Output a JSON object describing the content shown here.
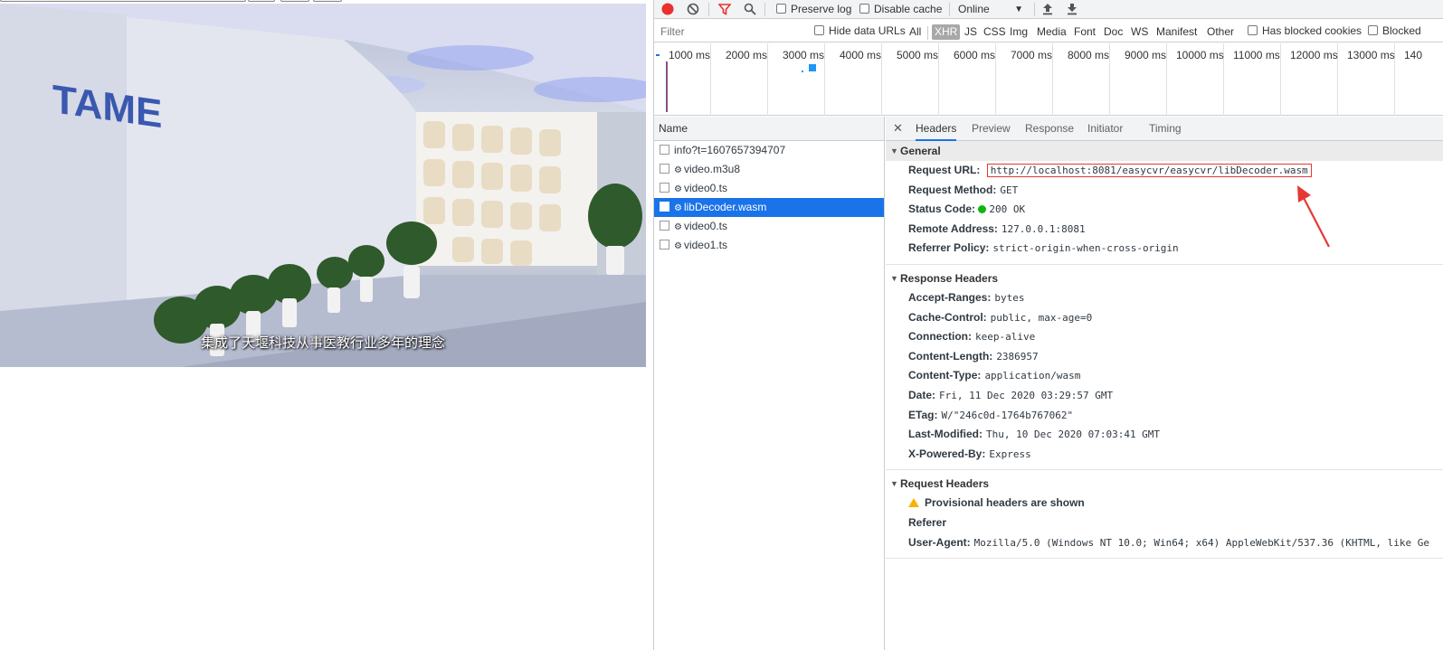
{
  "video": {
    "subtitle": "集成了天堰科技从事医教行业多年的理念"
  },
  "toolbar": {
    "preserve_log": "Preserve log",
    "disable_cache": "Disable cache",
    "throttle": "Online",
    "record_icon": "record-icon",
    "clear_icon": "clear-icon",
    "filter_icon": "filter-icon",
    "search_icon": "search-icon",
    "upload_icon": "upload-icon",
    "download_icon": "download-icon"
  },
  "filterbar": {
    "placeholder": "Filter",
    "hide_data_urls": "Hide data URLs",
    "types": [
      "All",
      "XHR",
      "JS",
      "CSS",
      "Img",
      "Media",
      "Font",
      "Doc",
      "WS",
      "Manifest",
      "Other"
    ],
    "active_type": "XHR",
    "has_blocked_cookies": "Has blocked cookies",
    "blocked": "Blocked"
  },
  "timeline": {
    "ticks": [
      "1000 ms",
      "2000 ms",
      "3000 ms",
      "4000 ms",
      "5000 ms",
      "6000 ms",
      "7000 ms",
      "8000 ms",
      "9000 ms",
      "10000 ms",
      "11000 ms",
      "12000 ms",
      "13000 ms",
      "140"
    ]
  },
  "requests": {
    "header": "Name",
    "rows": [
      {
        "name": "info?t=1607657394707",
        "gear": false,
        "selected": false
      },
      {
        "name": "video.m3u8",
        "gear": true,
        "selected": false
      },
      {
        "name": "video0.ts",
        "gear": true,
        "selected": false
      },
      {
        "name": "libDecoder.wasm",
        "gear": true,
        "selected": true
      },
      {
        "name": "video0.ts",
        "gear": true,
        "selected": false
      },
      {
        "name": "video1.ts",
        "gear": true,
        "selected": false
      }
    ]
  },
  "detail_tabs": [
    "Headers",
    "Preview",
    "Response",
    "Initiator",
    "Timing"
  ],
  "active_tab": "Headers",
  "general": {
    "title": "General",
    "rows": [
      {
        "key": "Request URL:",
        "value": "http://localhost:8081/easycvr/easycvr/libDecoder.wasm"
      },
      {
        "key": "Request Method:",
        "value": "GET"
      },
      {
        "key": "Status Code:",
        "value": "200 OK"
      },
      {
        "key": "Remote Address:",
        "value": "127.0.0.1:8081"
      },
      {
        "key": "Referrer Policy:",
        "value": "strict-origin-when-cross-origin"
      }
    ]
  },
  "response_headers": {
    "title": "Response Headers",
    "rows": [
      {
        "key": "Accept-Ranges:",
        "value": "bytes"
      },
      {
        "key": "Cache-Control:",
        "value": "public, max-age=0"
      },
      {
        "key": "Connection:",
        "value": "keep-alive"
      },
      {
        "key": "Content-Length:",
        "value": "2386957"
      },
      {
        "key": "Content-Type:",
        "value": "application/wasm"
      },
      {
        "key": "Date:",
        "value": "Fri, 11 Dec 2020 03:29:57 GMT"
      },
      {
        "key": "ETag:",
        "value": "W/\"246c0d-1764b767062\""
      },
      {
        "key": "Last-Modified:",
        "value": "Thu, 10 Dec 2020 07:03:41 GMT"
      },
      {
        "key": "X-Powered-By:",
        "value": "Express"
      }
    ]
  },
  "request_headers": {
    "title": "Request Headers",
    "warning": "Provisional headers are shown",
    "rows": [
      {
        "key": "Referer",
        "value": ""
      },
      {
        "key": "User-Agent:",
        "value": "Mozilla/5.0 (Windows NT 10.0; Win64; x64) AppleWebKit/537.36 (KHTML, like Ge"
      }
    ]
  },
  "colors": {
    "selected_row": "#1a73e8",
    "record": "#e8312f",
    "status_ok": "#0cb60c",
    "annotation": "#e53935"
  }
}
